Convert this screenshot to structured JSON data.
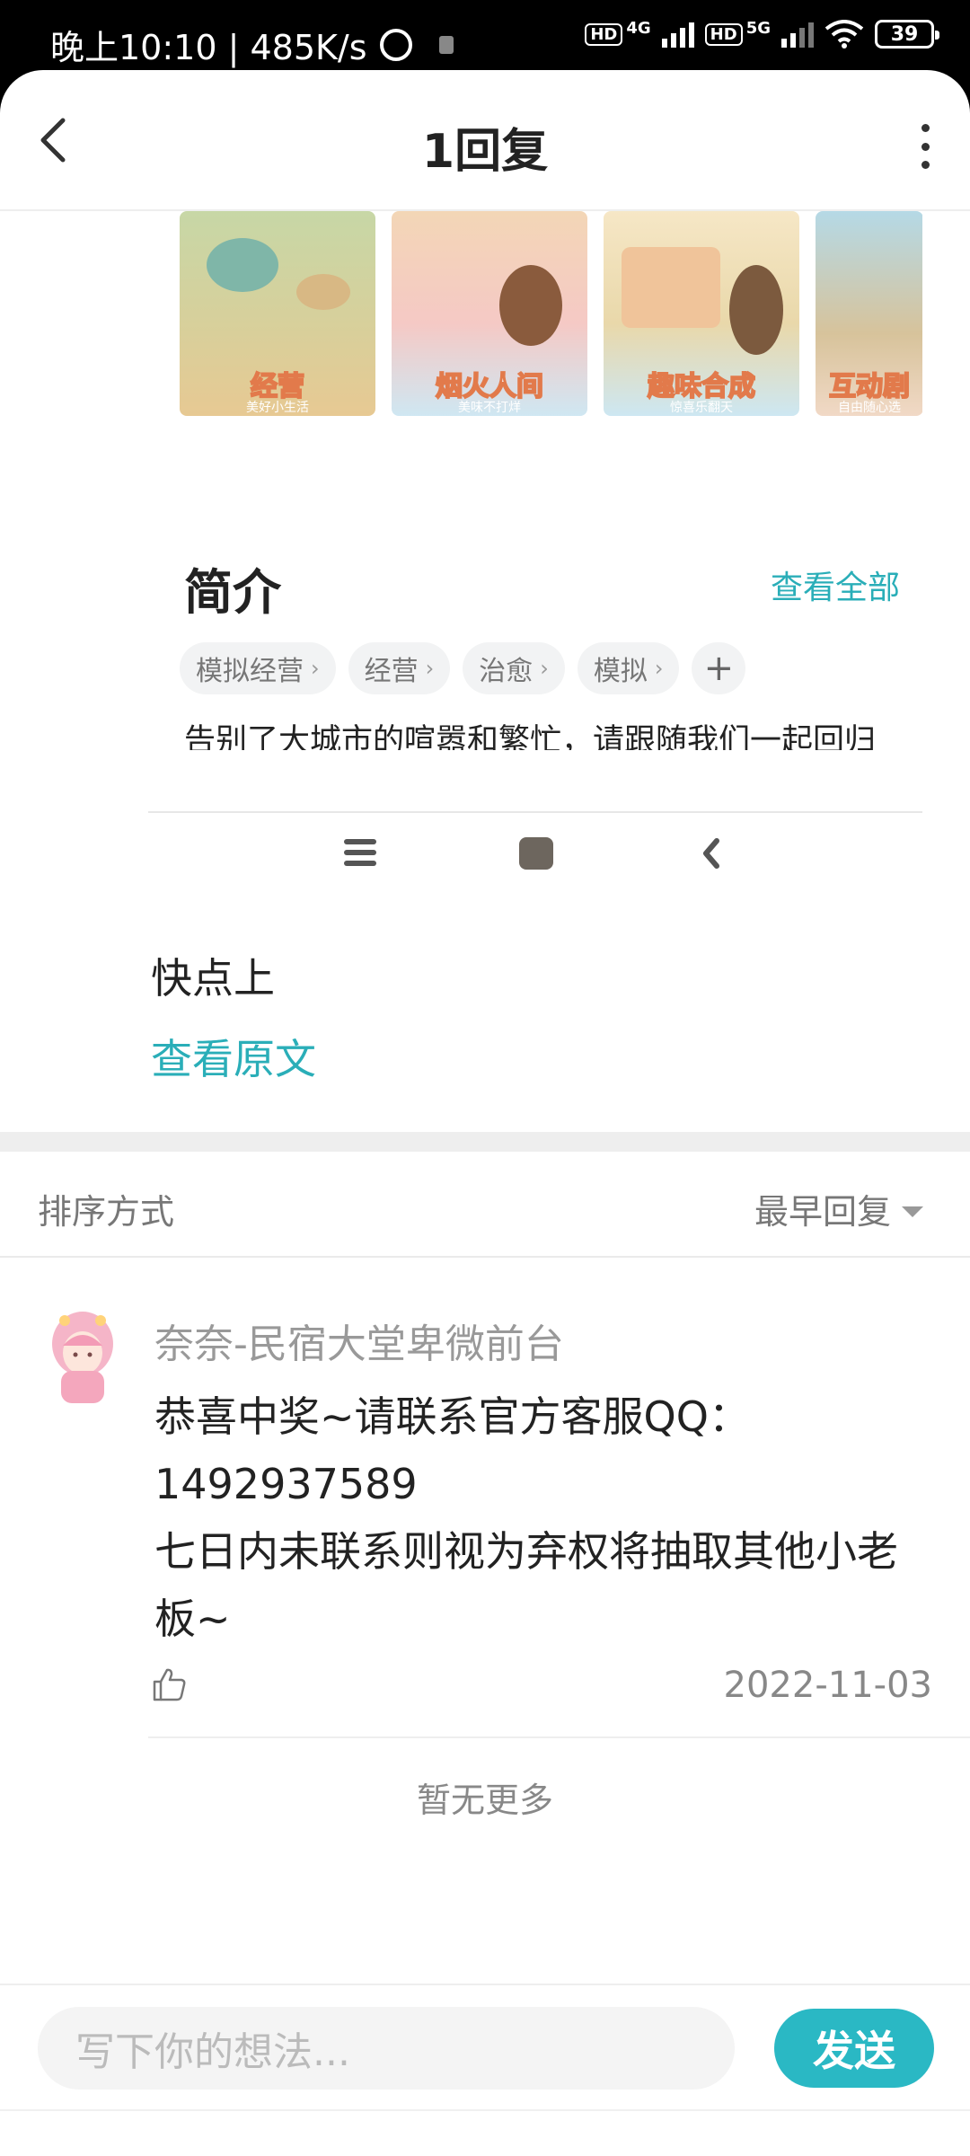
{
  "status_bar": {
    "time_speed": "晚上10:10 | 485K/s",
    "net1": "4G",
    "net2": "5G",
    "hd": "HD",
    "battery": "39"
  },
  "header": {
    "title": "1回复"
  },
  "embed": {
    "thumbnails": [
      {
        "caption": "经营",
        "sub": "美好小生活"
      },
      {
        "caption": "烟火人间",
        "sub": "美味不打烊"
      },
      {
        "caption": "趣味合成",
        "sub": "惊喜乐翻天"
      },
      {
        "caption": "互动剧",
        "sub": "自由随心选"
      }
    ],
    "intro_title": "简介",
    "view_all": "查看全部",
    "tags": [
      {
        "label": "模拟经营"
      },
      {
        "label": "经营"
      },
      {
        "label": "治愈"
      },
      {
        "label": "模拟"
      }
    ],
    "tag_add": "+",
    "intro_text": "告别了大城市的喧嚣和繁忙，请跟随我们一起回归芳草鲜美的乡下田园，经营民宿吧！"
  },
  "comment": {
    "text": "快点上",
    "view_original": "查看原文"
  },
  "sort": {
    "label": "排序方式",
    "value": "最早回复"
  },
  "reply": {
    "author": "奈奈-民宿大堂卑微前台",
    "text_line1": "恭喜中奖~请联系官方客服QQ：",
    "text_line2": "1492937589",
    "text_line3": "七日内未联系则视为弃权将抽取其他小老板~",
    "date": "2022-11-03"
  },
  "no_more": "暂无更多",
  "input": {
    "placeholder": "写下你的想法...",
    "send": "发送"
  },
  "colors": {
    "accent": "#2aaeb8",
    "send_button": "#2ab8c4"
  }
}
